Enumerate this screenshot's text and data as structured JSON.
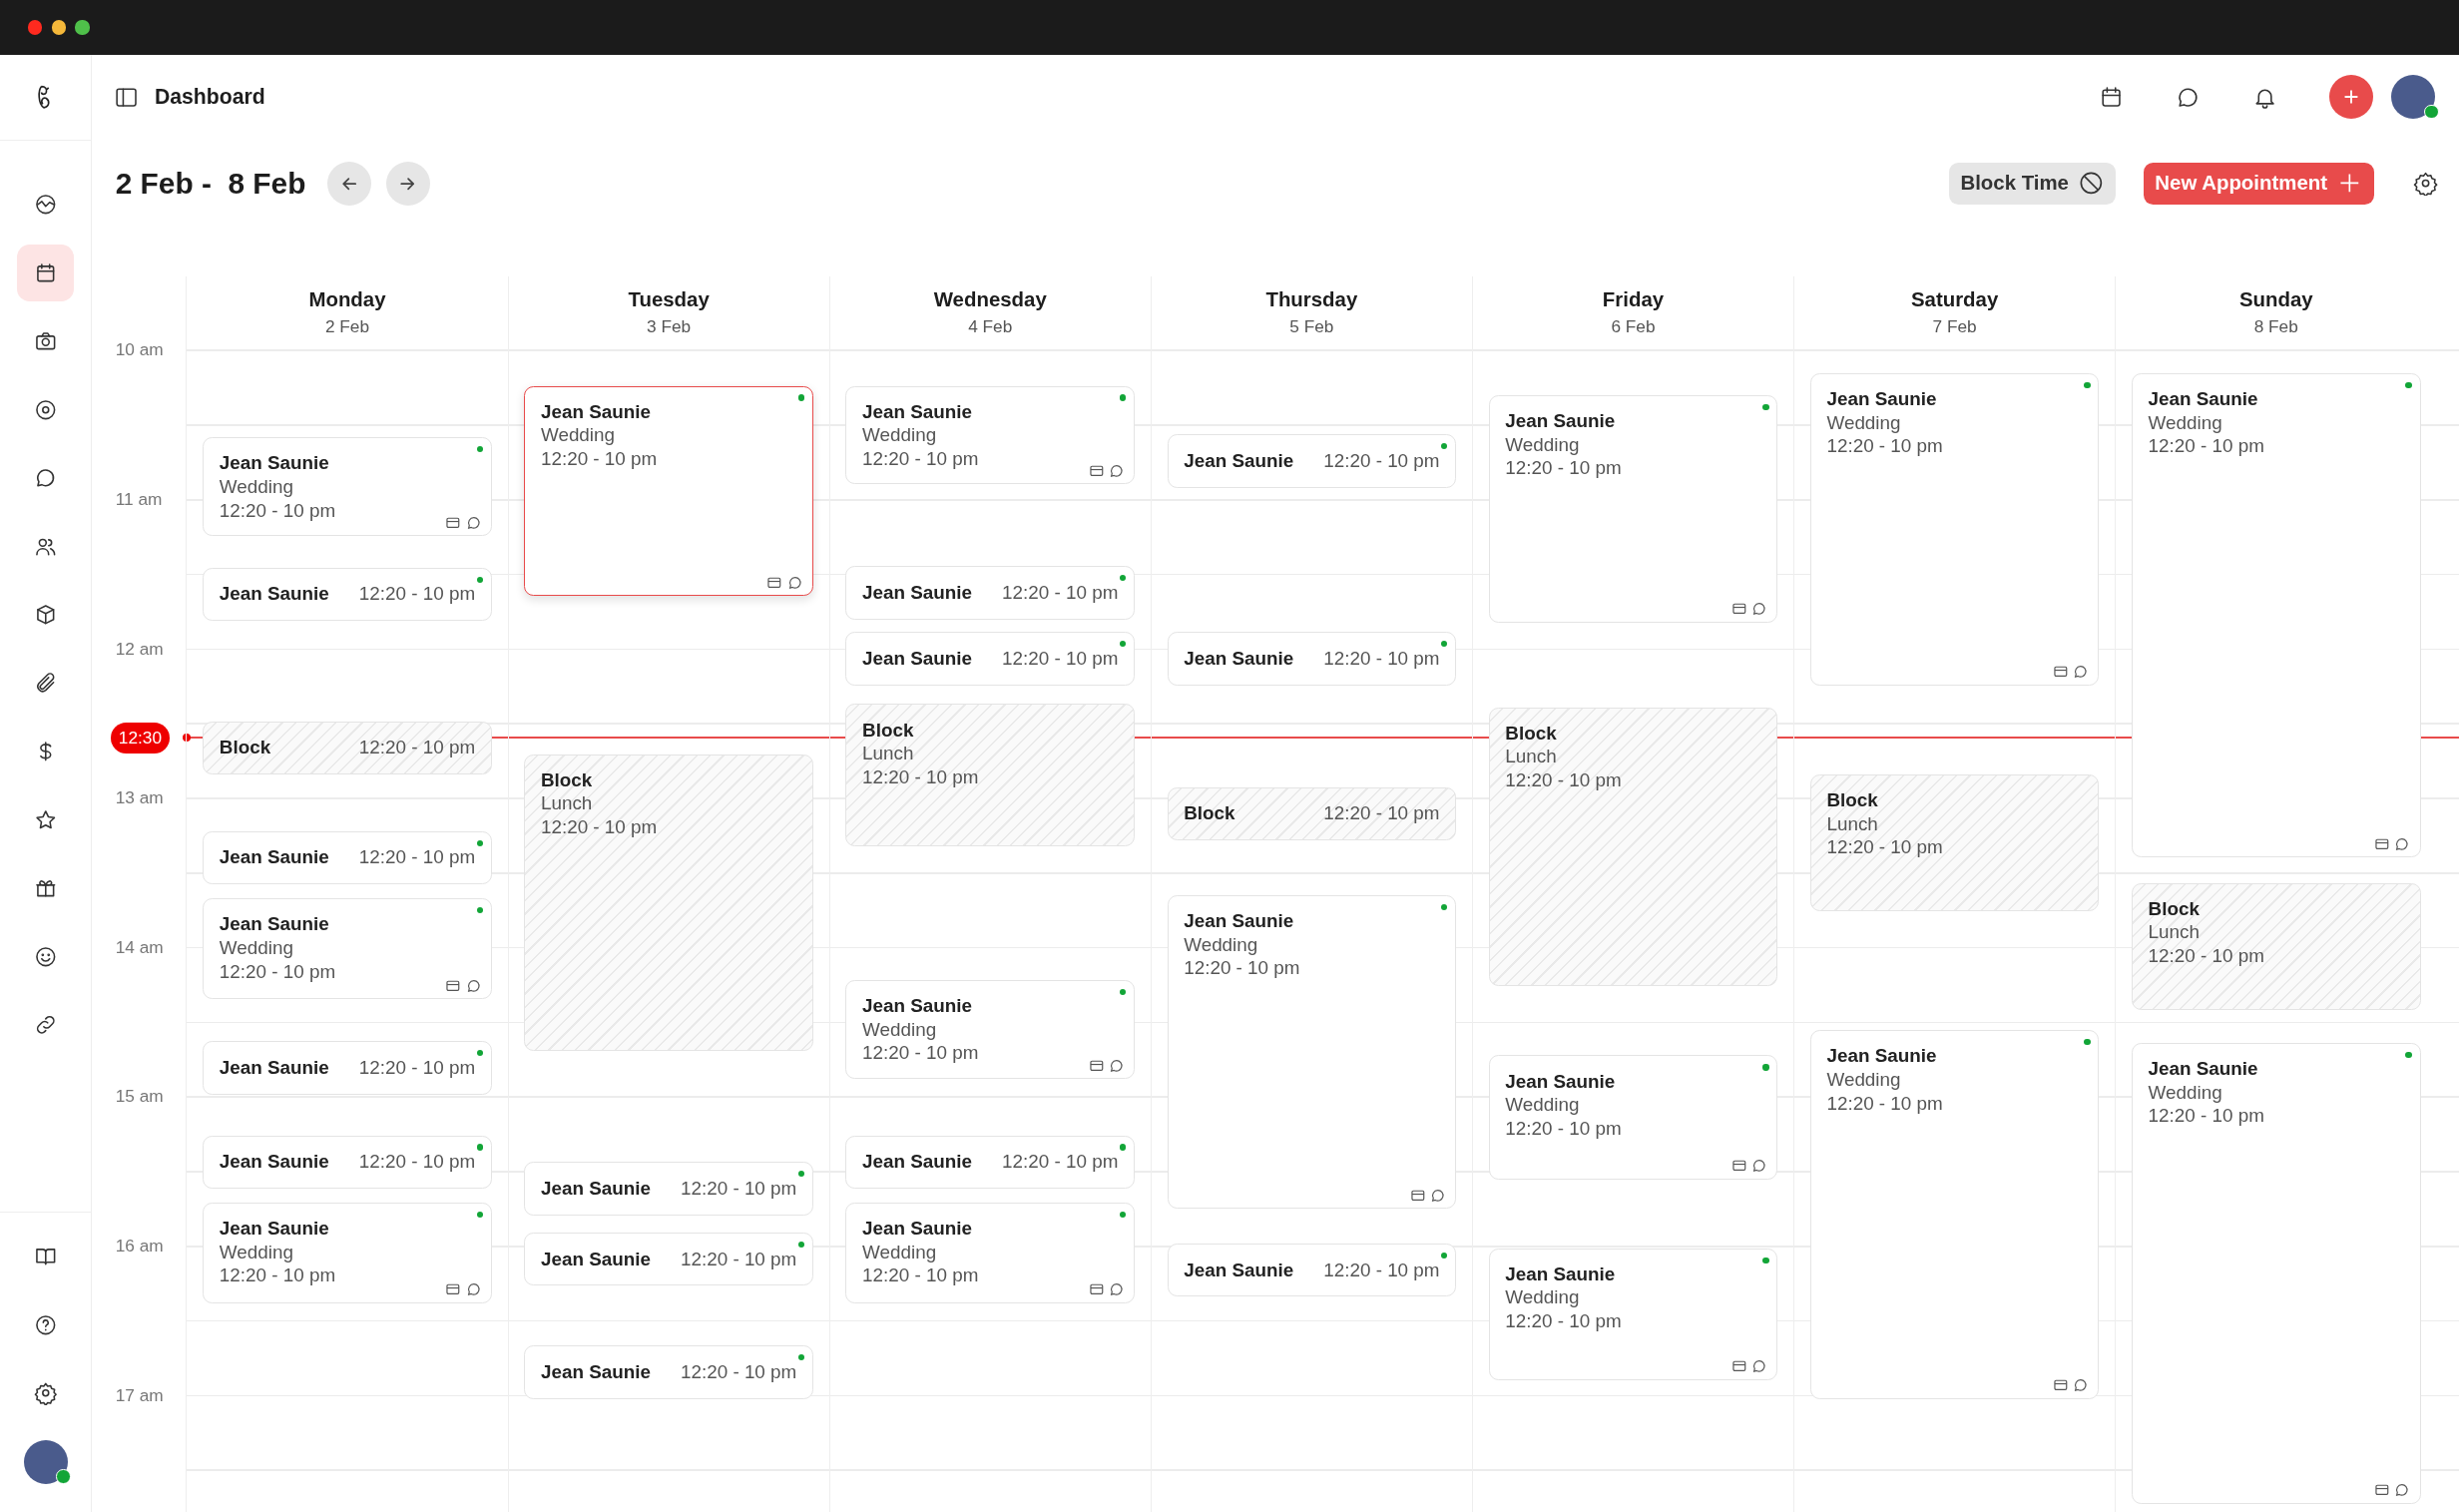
{
  "header": {
    "title": "Dashboard"
  },
  "sidebar": {
    "items": [
      {
        "selected": false
      },
      {
        "selected": true
      },
      {
        "selected": false
      },
      {
        "selected": false
      },
      {
        "selected": false
      },
      {
        "selected": false
      },
      {
        "selected": false
      },
      {
        "selected": false
      },
      {
        "selected": false
      },
      {
        "selected": false
      },
      {
        "selected": false
      },
      {
        "selected": false
      },
      {
        "selected": false
      }
    ],
    "bottom_items": [
      {
        "selected": false
      },
      {
        "selected": false
      },
      {
        "selected": false
      }
    ]
  },
  "toolbar": {
    "date_range": "2 Feb -  8 Feb",
    "block_button": "Block Time",
    "new_button": "New Appointment"
  },
  "calendar": {
    "hours": [
      "10 am",
      "11 am",
      "12 am",
      "13 am",
      "14 am",
      "15 am",
      "16 am",
      "17 am"
    ],
    "now": "12:30",
    "days": [
      {
        "name": "Monday",
        "date": "2 Feb",
        "events": [
          {
            "kind": "appointment",
            "title": "Jean Saunie",
            "detail": "Wedding",
            "time": "12:20 - 10 pm",
            "selected": false
          },
          {
            "kind": "appointment",
            "title": "Jean Saunie",
            "time": "12:20 - 10 pm",
            "selected": false
          },
          {
            "kind": "block",
            "title": "Block",
            "time": "12:20 - 10 pm",
            "selected": false
          },
          {
            "kind": "appointment",
            "title": "Jean Saunie",
            "time": "12:20 - 10 pm",
            "selected": false
          },
          {
            "kind": "appointment",
            "title": "Jean Saunie",
            "detail": "Wedding",
            "time": "12:20 - 10 pm",
            "selected": false
          },
          {
            "kind": "appointment",
            "title": "Jean Saunie",
            "time": "12:20 - 10 pm",
            "selected": false
          },
          {
            "kind": "appointment",
            "title": "Jean Saunie",
            "time": "12:20 - 10 pm",
            "selected": false
          },
          {
            "kind": "appointment",
            "title": "Jean Saunie",
            "detail": "Wedding",
            "time": "12:20 - 10 pm",
            "selected": false
          }
        ]
      },
      {
        "name": "Tuesday",
        "date": "3 Feb",
        "events": [
          {
            "kind": "appointment",
            "title": "Jean Saunie",
            "detail": "Wedding",
            "time": "12:20 - 10 pm",
            "selected": true
          },
          {
            "kind": "block",
            "title": "Block",
            "detail": "Lunch",
            "time": "12:20 - 10 pm",
            "selected": false
          },
          {
            "kind": "appointment",
            "title": "Jean Saunie",
            "time": "12:20 - 10 pm",
            "selected": false
          },
          {
            "kind": "appointment",
            "title": "Jean Saunie",
            "time": "12:20 - 10 pm",
            "selected": false
          },
          {
            "kind": "appointment",
            "title": "Jean Saunie",
            "time": "12:20 - 10 pm",
            "selected": false
          }
        ]
      },
      {
        "name": "Wednesday",
        "date": "4 Feb",
        "events": [
          {
            "kind": "appointment",
            "title": "Jean Saunie",
            "detail": "Wedding",
            "time": "12:20 - 10 pm",
            "selected": false
          },
          {
            "kind": "appointment",
            "title": "Jean Saunie",
            "time": "12:20 - 10 pm",
            "selected": false
          },
          {
            "kind": "appointment",
            "title": "Jean Saunie",
            "time": "12:20 - 10 pm",
            "selected": false
          },
          {
            "kind": "block",
            "title": "Block",
            "detail": "Lunch",
            "time": "12:20 - 10 pm",
            "selected": false
          },
          {
            "kind": "appointment",
            "title": "Jean Saunie",
            "detail": "Wedding",
            "time": "12:20 - 10 pm",
            "selected": false
          },
          {
            "kind": "appointment",
            "title": "Jean Saunie",
            "time": "12:20 - 10 pm",
            "selected": false
          },
          {
            "kind": "appointment",
            "title": "Jean Saunie",
            "detail": "Wedding",
            "time": "12:20 - 10 pm",
            "selected": false
          }
        ]
      },
      {
        "name": "Thursday",
        "date": "5 Feb",
        "events": [
          {
            "kind": "appointment",
            "title": "Jean Saunie",
            "time": "12:20 - 10 pm",
            "selected": false
          },
          {
            "kind": "appointment",
            "title": "Jean Saunie",
            "time": "12:20 - 10 pm",
            "selected": false
          },
          {
            "kind": "block",
            "title": "Block",
            "time": "12:20 - 10 pm",
            "selected": false
          },
          {
            "kind": "appointment",
            "title": "Jean Saunie",
            "detail": "Wedding",
            "time": "12:20 - 10 pm",
            "selected": false
          },
          {
            "kind": "appointment",
            "title": "Jean Saunie",
            "time": "12:20 - 10 pm",
            "selected": false
          }
        ]
      },
      {
        "name": "Friday",
        "date": "6 Feb",
        "events": [
          {
            "kind": "appointment",
            "title": "Jean Saunie",
            "detail": "Wedding",
            "time": "12:20 - 10 pm",
            "selected": false
          },
          {
            "kind": "block",
            "title": "Block",
            "detail": "Lunch",
            "time": "12:20 - 10 pm",
            "selected": false
          },
          {
            "kind": "appointment",
            "title": "Jean Saunie",
            "detail": "Wedding",
            "time": "12:20 - 10 pm",
            "selected": false
          },
          {
            "kind": "appointment",
            "title": "Jean Saunie",
            "detail": "Wedding",
            "time": "12:20 - 10 pm",
            "selected": false
          }
        ]
      },
      {
        "name": "Saturday",
        "date": "7 Feb",
        "events": [
          {
            "kind": "appointment",
            "title": "Jean Saunie",
            "detail": "Wedding",
            "time": "12:20 - 10 pm",
            "selected": false
          },
          {
            "kind": "block",
            "title": "Block",
            "detail": "Lunch",
            "time": "12:20 - 10 pm",
            "selected": false
          },
          {
            "kind": "appointment",
            "title": "Jean Saunie",
            "detail": "Wedding",
            "time": "12:20 - 10 pm",
            "selected": false
          }
        ]
      },
      {
        "name": "Sunday",
        "date": "8 Feb",
        "events": [
          {
            "kind": "appointment",
            "title": "Jean Saunie",
            "detail": "Wedding",
            "time": "12:20 - 10 pm",
            "selected": false
          },
          {
            "kind": "block",
            "title": "Block",
            "detail": "Lunch",
            "time": "12:20 - 10 pm",
            "selected": false
          },
          {
            "kind": "appointment",
            "title": "Jean Saunie",
            "detail": "Wedding",
            "time": "12:20 - 10 pm",
            "selected": false
          }
        ]
      }
    ]
  }
}
